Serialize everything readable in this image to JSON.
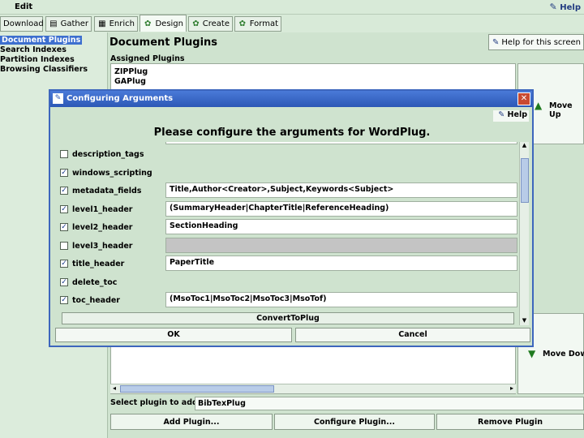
{
  "menubar": {
    "edit": "Edit",
    "help": "Help"
  },
  "tabs": [
    {
      "label": "Download",
      "icon": "download-icon"
    },
    {
      "label": "Gather",
      "icon": "gather-icon"
    },
    {
      "label": "Enrich",
      "icon": "enrich-icon"
    },
    {
      "label": "Design",
      "icon": "gear-icon"
    },
    {
      "label": "Create",
      "icon": "gear-icon"
    },
    {
      "label": "Format",
      "icon": "gear-icon"
    }
  ],
  "sidebar": {
    "items": [
      "Document Plugins",
      "Search Indexes",
      "Partition Indexes",
      "Browsing Classifiers"
    ]
  },
  "main": {
    "title": "Document Plugins",
    "help_button": "Help for this screen",
    "assigned_label": "Assigned Plugins",
    "plugins": [
      "ZIPPlug",
      "GAPlug"
    ],
    "move_up": "Move Up",
    "move_down": "Move Down",
    "select_label": "Select plugin to add:",
    "select_value": "BibTexPlug",
    "add_button": "Add Plugin...",
    "configure_button": "Configure Plugin...",
    "remove_button": "Remove Plugin"
  },
  "dialog": {
    "title": "Configuring Arguments",
    "help": "Help",
    "header": "Please configure the arguments for WordPlug.",
    "args": [
      {
        "label": "description_tags",
        "checked": false,
        "value": null
      },
      {
        "label": "windows_scripting",
        "checked": true,
        "value": null
      },
      {
        "label": "metadata_fields",
        "checked": true,
        "value": "Title,Author<Creator>,Subject,Keywords<Subject>"
      },
      {
        "label": "level1_header",
        "checked": true,
        "value": "(SummaryHeader|ChapterTitle|ReferenceHeading)"
      },
      {
        "label": "level2_header",
        "checked": true,
        "value": "SectionHeading"
      },
      {
        "label": "level3_header",
        "checked": false,
        "value": ""
      },
      {
        "label": "title_header",
        "checked": true,
        "value": "PaperTitle"
      },
      {
        "label": "delete_toc",
        "checked": true,
        "value": null
      },
      {
        "label": "toc_header",
        "checked": true,
        "value": "(MsoToc1|MsoToc2|MsoToc3|MsoTof)"
      }
    ],
    "convert_button": "ConvertToPlug",
    "ok": "OK",
    "cancel": "Cancel"
  }
}
